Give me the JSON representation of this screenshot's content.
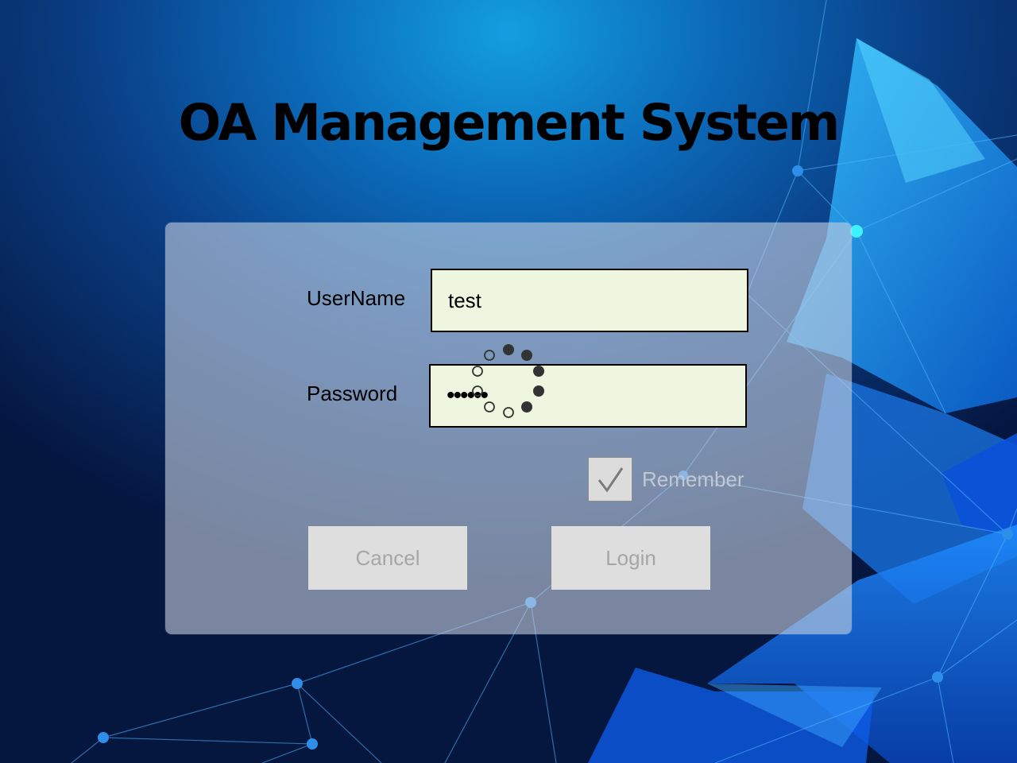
{
  "app": {
    "title": "OA Management System"
  },
  "login_form": {
    "username_label": "UserName",
    "username_value": "test",
    "password_label": "Password",
    "password_value": "••••••",
    "remember_label": "Remember",
    "remember_checked": true,
    "cancel_label": "Cancel",
    "login_label": "Login",
    "busy_indicator": "loading-spinner"
  },
  "colors": {
    "input_background": "#eef6e0",
    "button_background": "#dedede",
    "disabled_text": "#a6a6a6",
    "background_accent": "#0b69b8"
  }
}
